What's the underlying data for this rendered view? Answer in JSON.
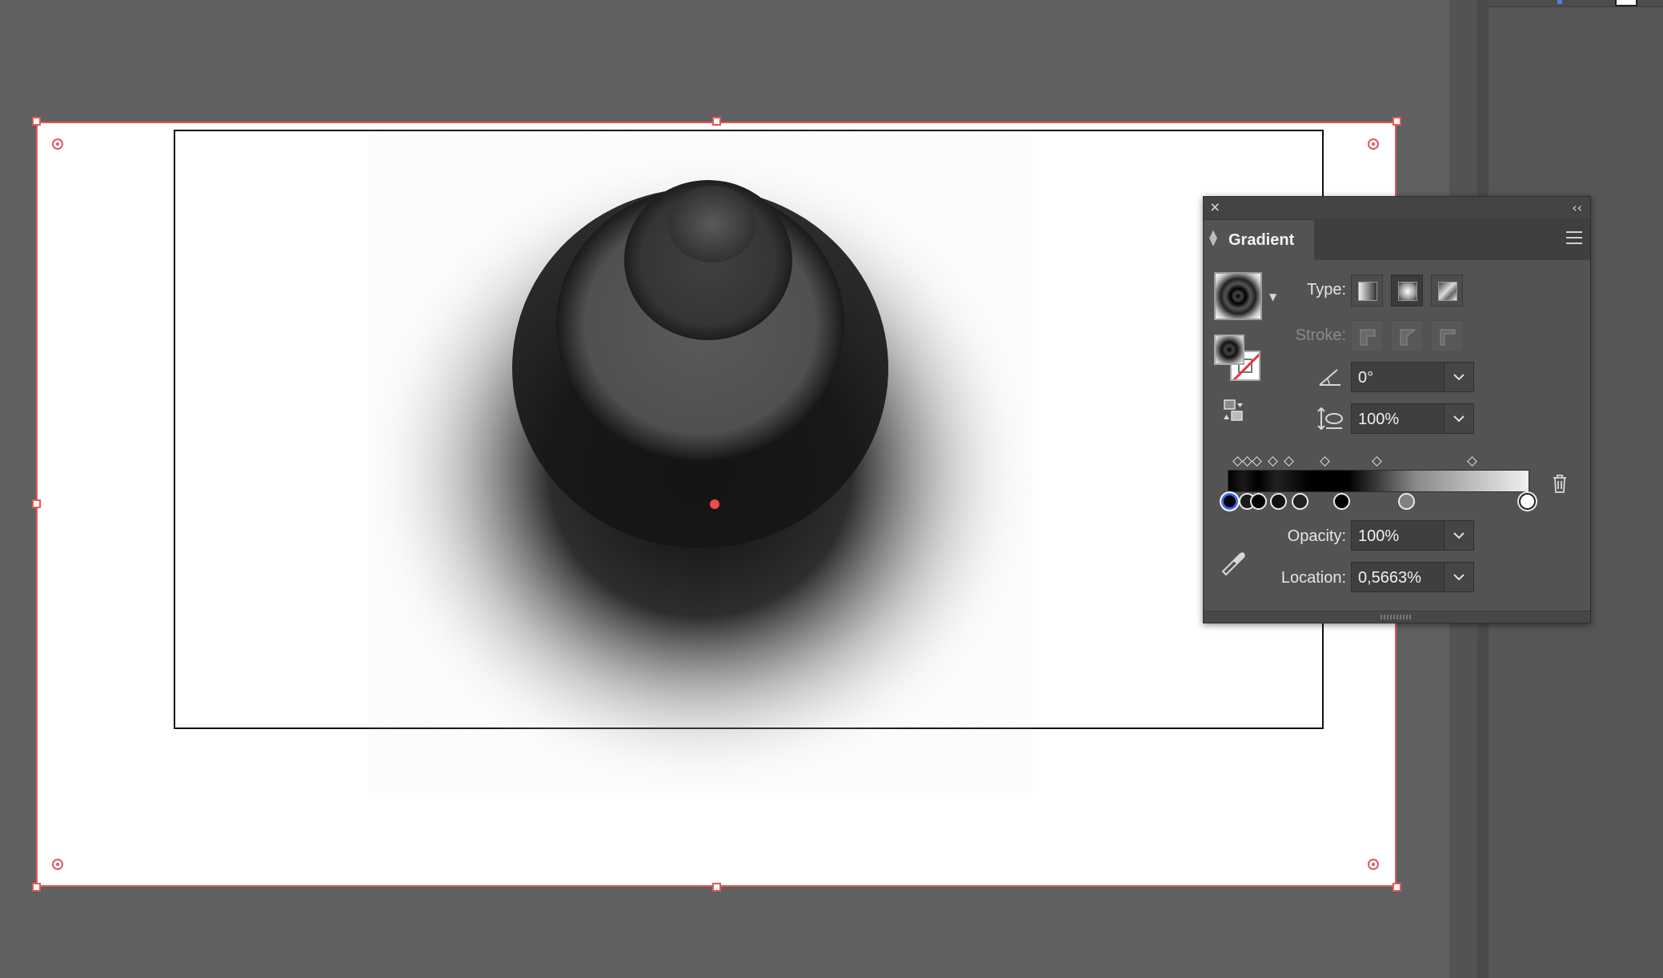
{
  "canvas": {
    "accent_color": "#e45858",
    "background": "#606060"
  },
  "gradient_panel": {
    "title": "Gradient",
    "close_icon": "close-icon",
    "collapse_label": "‹‹",
    "type_label": "Type:",
    "types": [
      "linear",
      "radial",
      "freeform"
    ],
    "selected_type": "radial",
    "stroke_label": "Stroke:",
    "stroke_options_state": "disabled",
    "angle_value": "0°",
    "aspect_ratio_value": "100%",
    "gradient_stops": [
      0.6,
      7,
      11,
      18,
      26,
      40,
      62,
      100
    ],
    "selected_stop_index": 0,
    "opacity_label": "Opacity:",
    "opacity_value": "100%",
    "location_label": "Location:",
    "location_value": "0,5663%"
  }
}
